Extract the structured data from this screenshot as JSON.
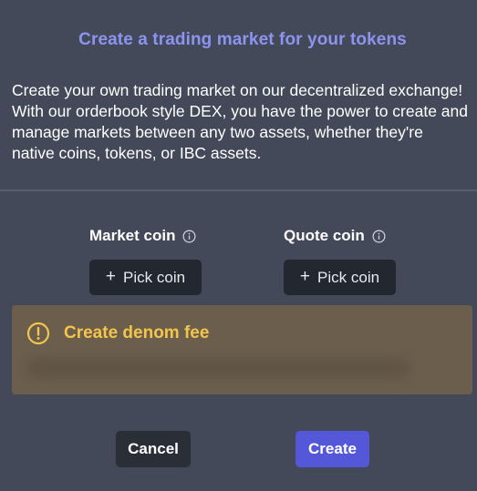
{
  "modal": {
    "title": "Create a trading market for your tokens",
    "description": "Create your own trading market on our decentralized exchange! With our orderbook style DEX, you have the power to create and manage markets between any two assets, whether they're native coins, tokens, or IBC assets."
  },
  "market_coin": {
    "label": "Market coin",
    "button_label": "Pick coin",
    "button_icon": "plus-icon",
    "info_icon": "info-icon"
  },
  "quote_coin": {
    "label": "Quote coin",
    "button_label": "Pick coin",
    "button_icon": "plus-icon",
    "info_icon": "info-icon"
  },
  "fee": {
    "title": "Create denom fee",
    "icon": "info-circle-icon"
  },
  "actions": {
    "cancel_label": "Cancel",
    "create_label": "Create"
  },
  "colors": {
    "background": "#434958",
    "title": "#8c94f0",
    "fee_box": "#6b5e4c",
    "fee_text": "#f3c54b",
    "primary_button": "#5557d9",
    "secondary_button": "#2a2e37"
  }
}
